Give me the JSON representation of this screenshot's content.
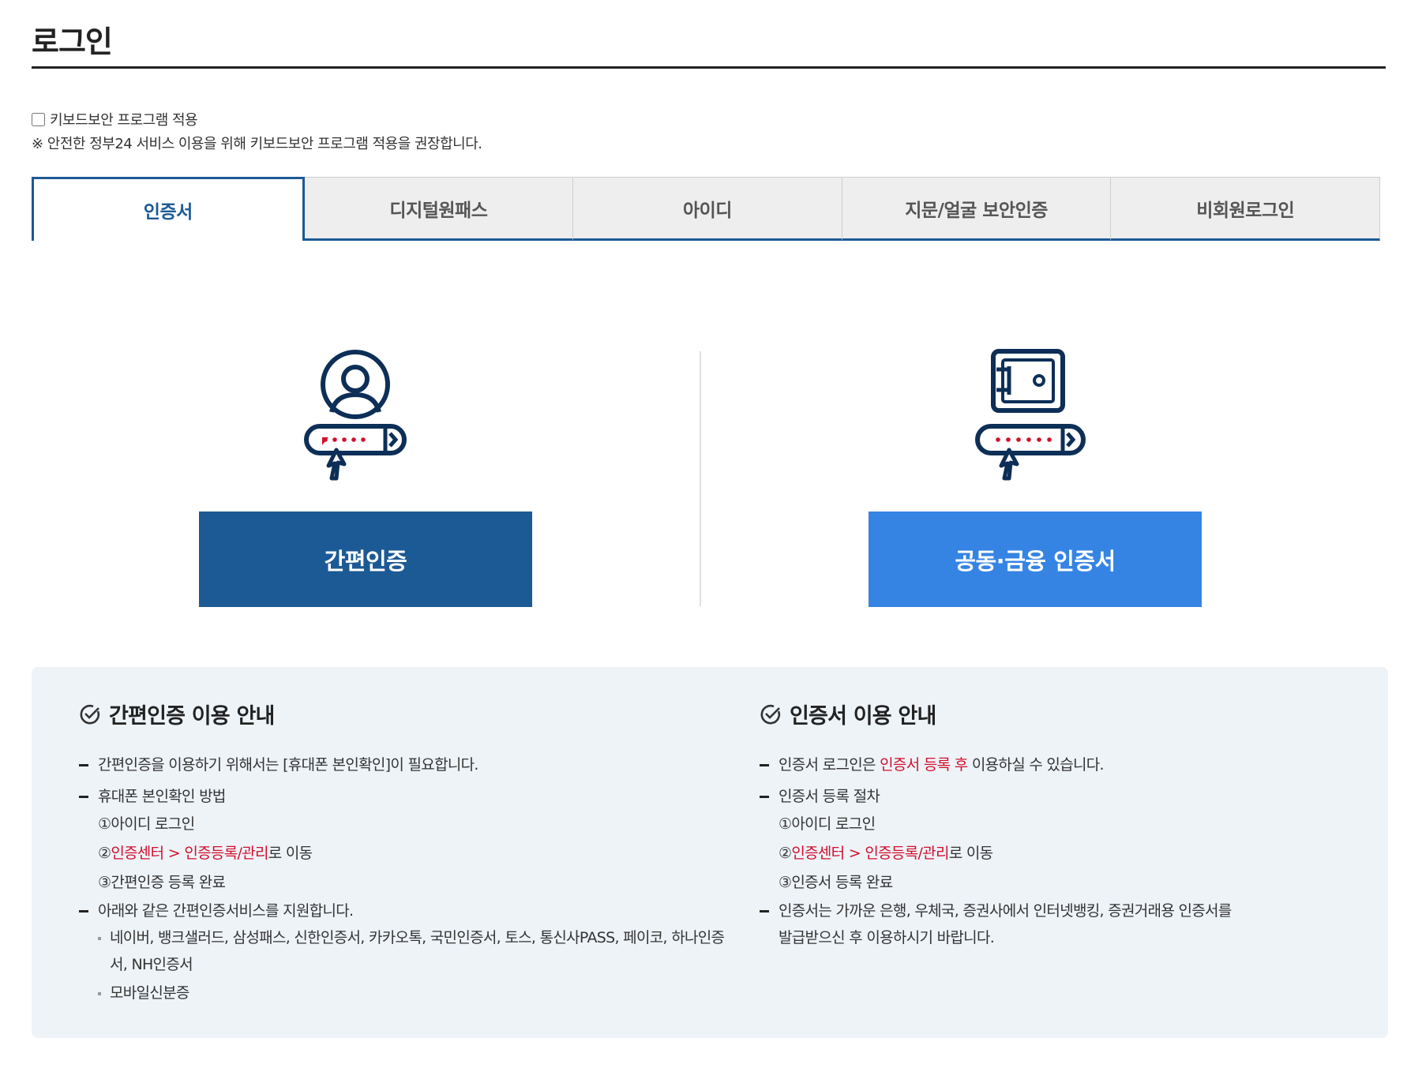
{
  "page": {
    "title": "로그인"
  },
  "keyboard": {
    "checkbox_label": "키보드보안 프로그램 적용",
    "checked": false,
    "note": "※ 안전한 정부24 서비스 이용을 위해 키보드보안 프로그램 적용을 권장합니다."
  },
  "tabs": [
    {
      "label": "인증서",
      "active": true
    },
    {
      "label": "디지털원패스",
      "active": false
    },
    {
      "label": "아이디",
      "active": false
    },
    {
      "label": "지문/얼굴 보안인증",
      "active": false
    },
    {
      "label": "비회원로그인",
      "active": false
    }
  ],
  "options": {
    "simple": {
      "icon": "user-password-icon",
      "button_label": "간편인증"
    },
    "cert": {
      "icon": "safe-password-icon",
      "button_label": "공동·금융 인증서"
    }
  },
  "colors": {
    "primary_dark": "#1c5a95",
    "primary_light": "#3584e4",
    "highlight_red": "#d20f2d",
    "panel_bg": "#eef3f8"
  },
  "info": {
    "simple": {
      "heading": "간편인증 이용 안내",
      "item1": "간편인증을 이용하기 위해서는 [휴대폰 본인확인]이 필요합니다.",
      "item2": "휴대폰 본인확인 방법",
      "step1": "①아이디 로그인",
      "step2_prefix": "②",
      "step2_red": "인증센터 > 인증등록/관리",
      "step2_suffix": "로 이동",
      "step3": "③간편인증 등록 완료",
      "item3": "아래와 같은 간편인증서비스를 지원합니다.",
      "services": "네이버, 뱅크샐러드, 삼성패스, 신한인증서, 카카오톡, 국민인증서, 토스, 통신사PASS, 페이코, 하나인증서, NH인증서",
      "mobile_id": "모바일신분증"
    },
    "cert": {
      "heading": "인증서 이용 안내",
      "item1_prefix": "인증서 로그인은 ",
      "item1_red": "인증서 등록 후",
      "item1_suffix": " 이용하실 수 있습니다.",
      "item2": "인증서 등록 절차",
      "step1": "①아이디 로그인",
      "step2_prefix": "②",
      "step2_red": "인증센터 > 인증등록/관리",
      "step2_suffix": "로 이동",
      "step3": "③인증서 등록 완료",
      "item3": "인증서는 가까운 은행, 우체국, 증권사에서 인터넷뱅킹, 증권거래용 인증서를 발급받으신 후 이용하시기 바랍니다."
    }
  }
}
